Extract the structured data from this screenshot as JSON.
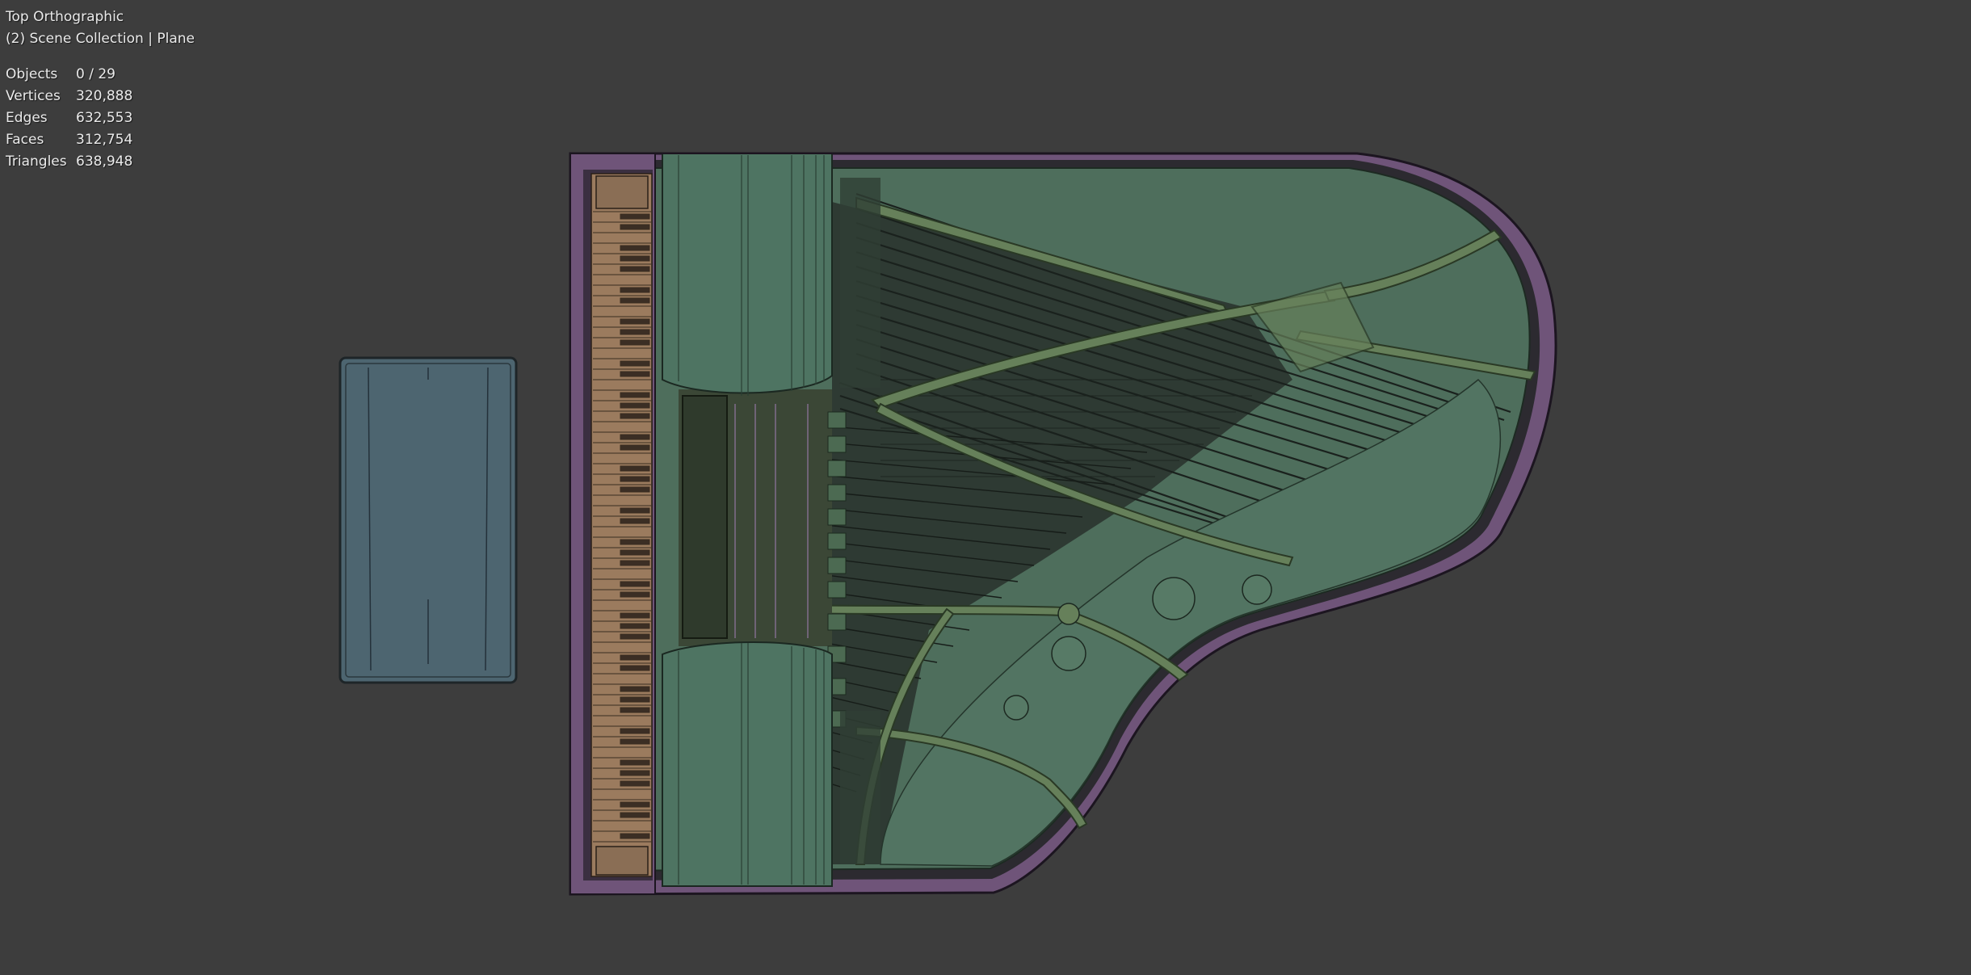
{
  "viewport": {
    "view_name": "Top Orthographic",
    "collection_info": "(2) Scene Collection | Plane"
  },
  "stats": [
    {
      "label": "Objects",
      "value": "0 / 29"
    },
    {
      "label": "Vertices",
      "value": "320,888"
    },
    {
      "label": "Edges",
      "value": "632,553"
    },
    {
      "label": "Faces",
      "value": "312,754"
    },
    {
      "label": "Triangles",
      "value": "638,948"
    }
  ],
  "colors": {
    "background": "#3d3d3d",
    "case_purple": "#6f5479",
    "soundboard_green": "#4e6e5c",
    "frame_green": "#66805a",
    "bench_blue": "#4d6570",
    "key_tan": "#9b7b5e"
  },
  "scene": {
    "objects": [
      "piano-bench",
      "grand-piano-case",
      "keyboard",
      "cast-iron-frame",
      "strings",
      "soundboard"
    ]
  }
}
